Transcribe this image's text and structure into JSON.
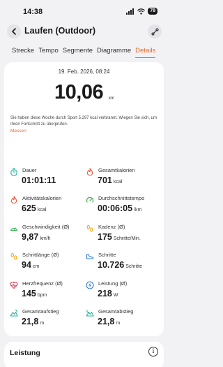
{
  "status_bar": {
    "time": "14:38",
    "battery": "78"
  },
  "header": {
    "title": "Laufen (Outdoor)"
  },
  "tabs": [
    {
      "label": "Strecke",
      "active": false
    },
    {
      "label": "Tempo",
      "active": false
    },
    {
      "label": "Segmente",
      "active": false
    },
    {
      "label": "Diagramme",
      "active": false
    },
    {
      "label": "Details",
      "active": true
    }
  ],
  "summary": {
    "date": "19. Feb. 2026, 08:24",
    "distance": "10,06",
    "distance_unit": "km",
    "info_text": "Sie haben diese Woche durch Sport 5.297 kcal verbrannt. Wiegen Sie sich, um Ihren Fortschritt zu überprüfen.",
    "measure_link": "Messen"
  },
  "metrics": [
    {
      "label": "Dauer",
      "value": "01:01:11",
      "unit": "",
      "icon": "stopwatch-icon",
      "color": "#2bb3a4"
    },
    {
      "label": "Gesamtkalorien",
      "value": "701",
      "unit": "kcal",
      "icon": "flame-icon",
      "color": "#e8583a"
    },
    {
      "label": "Aktivitätskalorien",
      "value": "625",
      "unit": "kcal",
      "icon": "flame-icon",
      "color": "#e8583a"
    },
    {
      "label": "Durchschnittstempo",
      "value": "00:06:05",
      "unit": "/km",
      "icon": "gauge-icon",
      "color": "#34b34a"
    },
    {
      "label": "Geschwindigkeit (Ø)",
      "value": "9,87",
      "unit": "km/h",
      "icon": "speedometer-icon",
      "color": "#34b34a"
    },
    {
      "label": "Kadenz (Ø)",
      "value": "175",
      "unit": "Schritte/Min.",
      "icon": "footprints-icon",
      "color": "#f0a81c"
    },
    {
      "label": "Schrittlänge (Ø)",
      "value": "94",
      "unit": "cm",
      "icon": "footprints-icon",
      "color": "#f0a81c"
    },
    {
      "label": "Schritte",
      "value": "10.726",
      "unit": "Schritte",
      "icon": "shoe-icon",
      "color": "#2f7bd6"
    },
    {
      "label": "Herzfrequenz (Ø)",
      "value": "145",
      "unit": "bpm",
      "icon": "heart-rate-icon",
      "color": "#e8364f"
    },
    {
      "label": "Leistung (Ø)",
      "value": "218",
      "unit": "W",
      "icon": "power-icon",
      "color": "#2f7bd6"
    },
    {
      "label": "Gesamtaufstieg",
      "value": "21,8",
      "unit": "m",
      "icon": "ascent-icon",
      "color": "#2bb3a4"
    },
    {
      "label": "Gesamtabstieg",
      "value": "21,8",
      "unit": "m",
      "icon": "descent-icon",
      "color": "#2bb3a4"
    }
  ],
  "section": {
    "title": "Leistung"
  }
}
